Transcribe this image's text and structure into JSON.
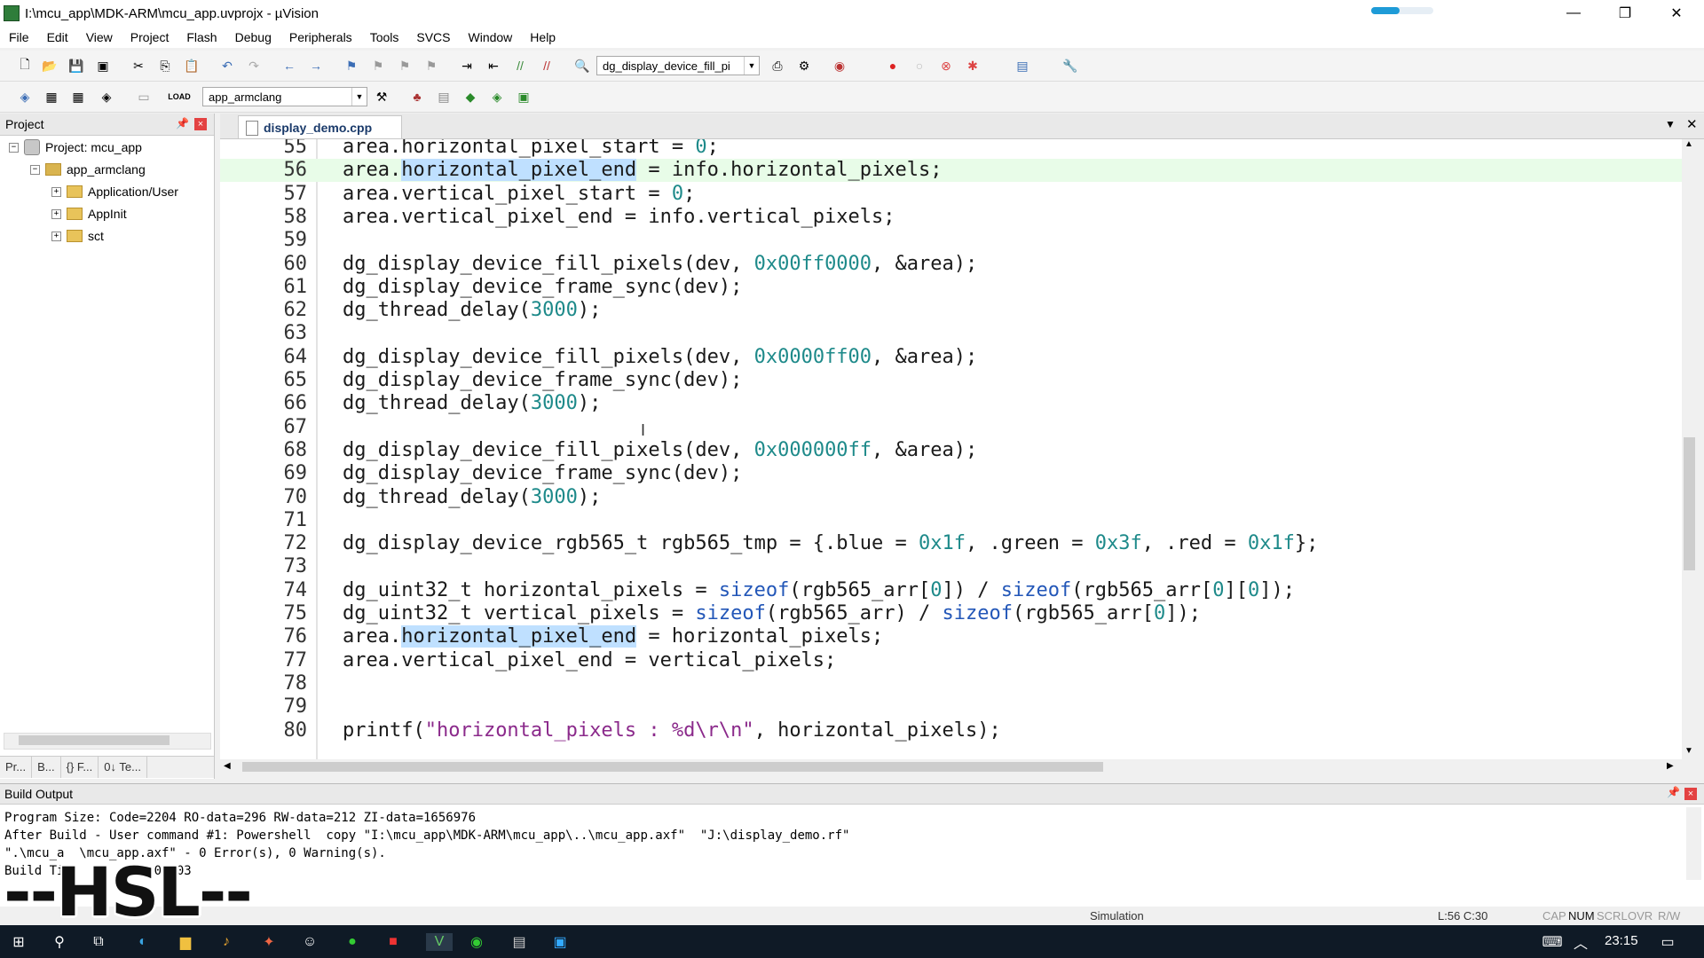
{
  "window": {
    "title": "I:\\mcu_app\\MDK-ARM\\mcu_app.uvprojx - µVision",
    "min": "—",
    "restore": "❐",
    "close": "✕"
  },
  "menu": [
    "File",
    "Edit",
    "View",
    "Project",
    "Flash",
    "Debug",
    "Peripherals",
    "Tools",
    "SVCS",
    "Window",
    "Help"
  ],
  "toolbar1": {
    "combo_value": "dg_display_device_fill_pi"
  },
  "toolbar2": {
    "target_value": "app_armclang",
    "load_label": "LOAD"
  },
  "project_panel": {
    "title": "Project",
    "tree": [
      {
        "label": "Project: mcu_app",
        "expand": "−"
      },
      {
        "label": "app_armclang",
        "expand": "−"
      },
      {
        "label": "Application/User",
        "expand": "+"
      },
      {
        "label": "AppInit",
        "expand": "+"
      },
      {
        "label": "sct",
        "expand": "+"
      }
    ],
    "tabs": [
      "Pr...",
      "B...",
      "{} F...",
      "0↓ Te..."
    ]
  },
  "editor": {
    "tab": "display_demo.cpp",
    "lines": [
      {
        "n": "55",
        "t": "area.horizontal_pixel_start = 0;"
      },
      {
        "n": "56",
        "t": "area.horizontal_pixel_end = info.horizontal_pixels;"
      },
      {
        "n": "57",
        "t": "area.vertical_pixel_start = 0;"
      },
      {
        "n": "58",
        "t": "area.vertical_pixel_end = info.vertical_pixels;"
      },
      {
        "n": "59",
        "t": ""
      },
      {
        "n": "60",
        "t": "dg_display_device_fill_pixels(dev, 0x00ff0000, &area);"
      },
      {
        "n": "61",
        "t": "dg_display_device_frame_sync(dev);"
      },
      {
        "n": "62",
        "t": "dg_thread_delay(3000);"
      },
      {
        "n": "63",
        "t": ""
      },
      {
        "n": "64",
        "t": "dg_display_device_fill_pixels(dev, 0x0000ff00, &area);"
      },
      {
        "n": "65",
        "t": "dg_display_device_frame_sync(dev);"
      },
      {
        "n": "66",
        "t": "dg_thread_delay(3000);"
      },
      {
        "n": "67",
        "t": ""
      },
      {
        "n": "68",
        "t": "dg_display_device_fill_pixels(dev, 0x000000ff, &area);"
      },
      {
        "n": "69",
        "t": "dg_display_device_frame_sync(dev);"
      },
      {
        "n": "70",
        "t": "dg_thread_delay(3000);"
      },
      {
        "n": "71",
        "t": ""
      },
      {
        "n": "72",
        "t": "dg_display_device_rgb565_t rgb565_tmp = {.blue = 0x1f, .green = 0x3f, .red = 0x1f};"
      },
      {
        "n": "73",
        "t": ""
      },
      {
        "n": "74",
        "t": "dg_uint32_t horizontal_pixels = sizeof(rgb565_arr[0]) / sizeof(rgb565_arr[0][0]);"
      },
      {
        "n": "75",
        "t": "dg_uint32_t vertical_pixels = sizeof(rgb565_arr) / sizeof(rgb565_arr[0]);"
      },
      {
        "n": "76",
        "t": "area.horizontal_pixel_end = horizontal_pixels;"
      },
      {
        "n": "77",
        "t": "area.vertical_pixel_end = vertical_pixels;"
      },
      {
        "n": "78",
        "t": ""
      },
      {
        "n": "79",
        "t": ""
      },
      {
        "n": "80",
        "t": "printf(\"horizontal_pixels : %d\\r\\n\", horizontal_pixels);"
      }
    ],
    "current_line": "56",
    "highlight_word": "horizontal_pixel_end"
  },
  "build_output": {
    "title": "Build Output",
    "lines": [
      "Program Size: Code=2204 RO-data=296 RW-data=212 ZI-data=1656976",
      "After Build - User command #1: Powershell  copy \"I:\\mcu_app\\MDK-ARM\\mcu_app\\..\\mcu_app.axf\"  \"J:\\display_demo.rf\"",
      "\".\\mcu_a  \\mcu_app.axf\" - 0 Error(s), 0 Warning(s).",
      "Build Ti         00:00:03"
    ]
  },
  "watermark": "--HSL--",
  "status": {
    "mode": "Simulation",
    "cursor": "L:56 C:30",
    "flags": [
      "CAP",
      "NUM",
      "SCRL",
      "OVR",
      "R/W"
    ]
  },
  "taskbar": {
    "clock": "23:15"
  },
  "colors": {
    "current_line": "#e8fce8",
    "selection": "#bfe0ff",
    "number": "#1e8a8a",
    "keyword": "#2357b8",
    "string": "#8b2a8b"
  }
}
